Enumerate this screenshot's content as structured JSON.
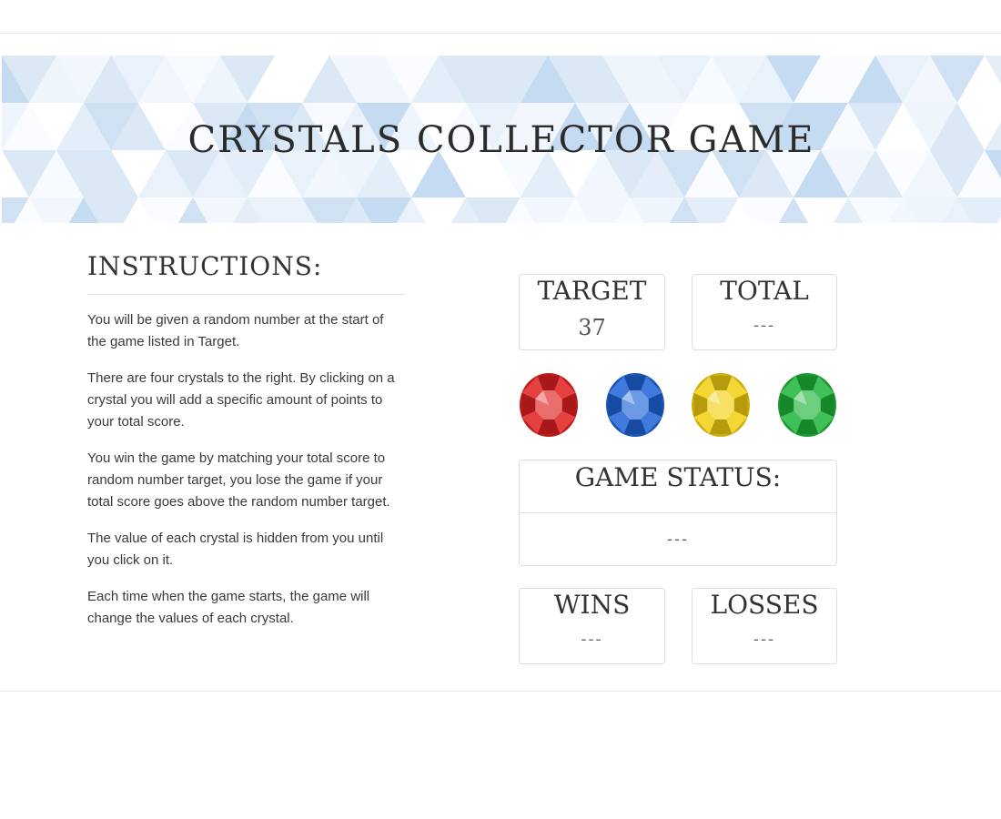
{
  "banner": {
    "title": "CRYSTALS COLLECTOR GAME"
  },
  "instructions": {
    "heading": "INSTRUCTIONS:",
    "paragraphs": [
      "You will be given a random number at the start of the game listed in Target.",
      "There are four crystals to the right. By clicking on a crystal you will add a specific amount of points to your total score.",
      "You win the game by matching your total score to random number target, you lose the game if your total score goes above the random number target.",
      "The value of each crystal is hidden from you until you click on it.",
      "Each time when the game starts, the game will change the values of each crystal."
    ]
  },
  "scoreboard": {
    "target": {
      "label": "TARGET",
      "value": "37"
    },
    "total": {
      "label": "TOTAL",
      "value": "---"
    },
    "status": {
      "label": "GAME STATUS:",
      "value": "---"
    },
    "wins": {
      "label": "WINS",
      "value": "---"
    },
    "losses": {
      "label": "LOSSES",
      "value": "---"
    }
  },
  "crystals": [
    {
      "name": "red-crystal",
      "color": "#e02020"
    },
    {
      "name": "blue-crystal",
      "color": "#1e63d6"
    },
    {
      "name": "yellow-crystal",
      "color": "#f2cf10"
    },
    {
      "name": "green-crystal",
      "color": "#1fb43a"
    }
  ]
}
